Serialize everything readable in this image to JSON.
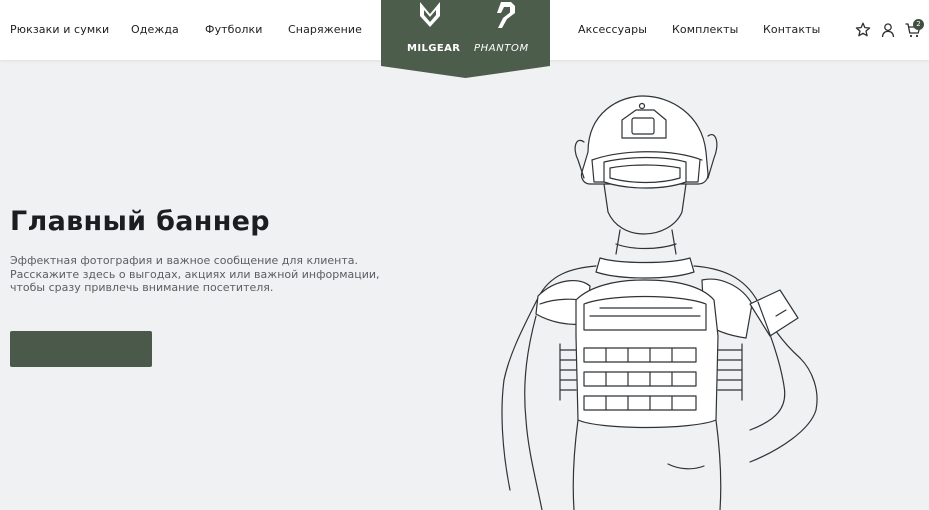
{
  "header": {
    "nav_left": [
      "Рюкзаки и сумки",
      "Одежда",
      "Футболки",
      "Снаряжение"
    ],
    "nav_right": [
      "Аксессуары",
      "Комплекты",
      "Контакты"
    ],
    "logo_left": "MILGEAR",
    "logo_right": "PHANTOM",
    "cart_count": "2",
    "icons": [
      "star-icon",
      "user-icon",
      "cart-icon"
    ]
  },
  "hero": {
    "title": "Главный баннер",
    "text_lines": [
      "Эффектная фотография и важное сообщение для клиента.",
      "Расскажите здесь о выгодах, акциях или важной информации,",
      "чтобы сразу привлечь внимание посетителя."
    ],
    "button_label": ""
  },
  "colors": {
    "accent": "#4a5949",
    "logo_plate": "#4d5d4c",
    "background": "#f0f1f3",
    "header_bg": "#ffffff"
  }
}
